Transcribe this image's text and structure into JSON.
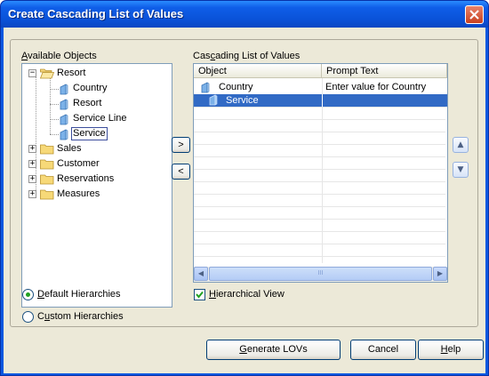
{
  "window": {
    "title": "Create Cascading List of Values"
  },
  "available_objects": {
    "label_prefix": "",
    "label_mnemonic": "A",
    "label_rest": "vailable Objects",
    "tree": [
      {
        "label": "Resort",
        "expanded": true,
        "children": [
          "Country",
          "Resort",
          "Service Line",
          "Service"
        ]
      },
      {
        "label": "Sales"
      },
      {
        "label": "Customer"
      },
      {
        "label": "Reservations"
      },
      {
        "label": "Measures"
      }
    ]
  },
  "cascading": {
    "label_prefix": "Cas",
    "label_mnemonic": "c",
    "label_rest": "ading List of Values",
    "columns": [
      "Object",
      "Prompt Text"
    ],
    "rows": [
      {
        "object": "Country",
        "prompt": "Enter value for Country"
      },
      {
        "object": "Service",
        "prompt": ""
      }
    ],
    "scroll_thumb_glyph": "III",
    "hierarchical_view_mnemonic": "H",
    "hierarchical_view_rest": "ierarchical View",
    "hierarchical_view_checked": true
  },
  "buttons": {
    "add_glyph": ">",
    "remove_glyph": "<",
    "move_up_glyph": "▲",
    "move_down_glyph": "▼",
    "generate_mnemonic": "G",
    "generate_rest": "enerate LOVs",
    "cancel": "Cancel",
    "help_mnemonic": "H",
    "help_rest": "elp"
  },
  "hierarchy_options": {
    "default_mnemonic": "D",
    "default_rest": "efault Hierarchies",
    "custom_prefix": "C",
    "custom_mnemonic": "u",
    "custom_rest": "stom Hierarchies",
    "selected": "default"
  },
  "colors": {
    "selection": "#316ac5",
    "title_bar": "#0a52d8",
    "dialog_bg": "#ece9d8"
  }
}
